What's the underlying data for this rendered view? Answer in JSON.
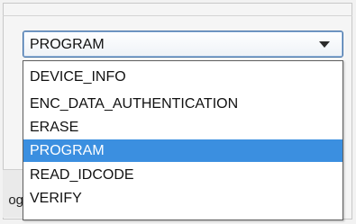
{
  "combobox": {
    "selected_value": "PROGRAM",
    "expanded": true
  },
  "dropdown": {
    "options": [
      {
        "label": "DEVICE_INFO",
        "selected": false
      },
      {
        "label": "ENC_DATA_AUTHENTICATION",
        "selected": false
      },
      {
        "label": "ERASE",
        "selected": false
      },
      {
        "label": "PROGRAM",
        "selected": true
      },
      {
        "label": "READ_IDCODE",
        "selected": false
      },
      {
        "label": "VERIFY",
        "selected": false
      }
    ]
  },
  "background": {
    "partial_label": "og"
  },
  "colors": {
    "selection_highlight": "#3b8fe0",
    "selection_text": "#ffffff",
    "combobox_border": "#3f6ea3",
    "window_background": "#f2f2f2"
  },
  "icons": {
    "dropdown_arrow": "triangle-down"
  }
}
